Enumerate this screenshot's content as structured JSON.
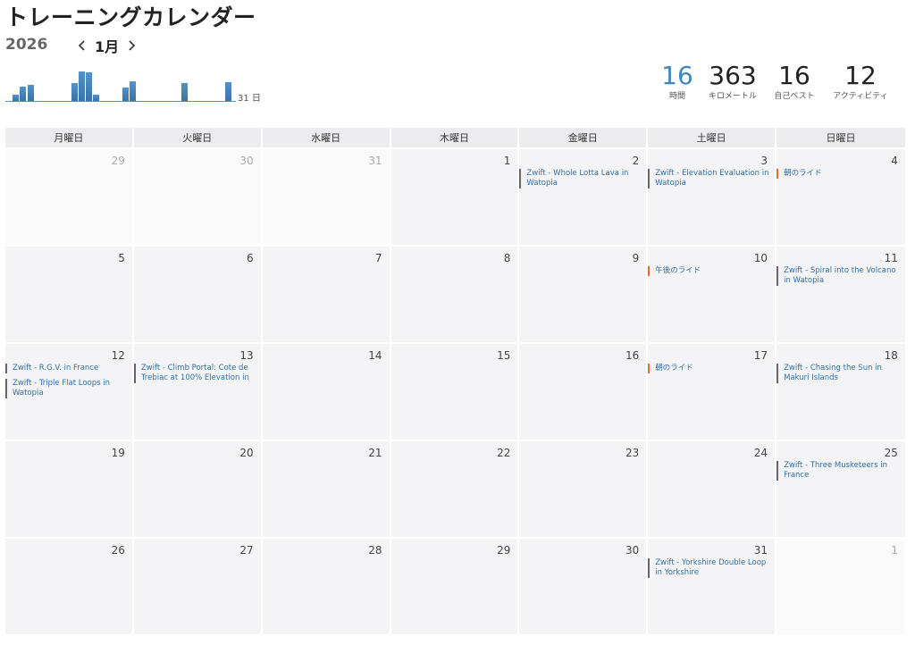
{
  "page": {
    "title": "トレーニングカレンダー",
    "year": "2026",
    "month": "1月"
  },
  "icons": {
    "prev": "chevron-left-icon",
    "next": "chevron-right-icon"
  },
  "colors": {
    "accent": "#3f86c1",
    "event_default_marker": "#666666",
    "event_outdoor_marker": "#e06a38",
    "event_text": "#2f6fa8"
  },
  "histogram": {
    "days_label": "31 日",
    "bars": [
      {
        "day": 2,
        "level": 0.2
      },
      {
        "day": 3,
        "level": 0.45
      },
      {
        "day": 4,
        "level": 0.5
      },
      {
        "day": 10,
        "level": 0.55
      },
      {
        "day": 11,
        "level": 0.92
      },
      {
        "day": 12,
        "level": 0.88
      },
      {
        "day": 13,
        "level": 0.2
      },
      {
        "day": 17,
        "level": 0.42
      },
      {
        "day": 18,
        "level": 0.6
      },
      {
        "day": 25,
        "level": 0.55
      },
      {
        "day": 31,
        "level": 0.58
      }
    ]
  },
  "stats": [
    {
      "value": "16",
      "label": "時間",
      "accent": true
    },
    {
      "value": "363",
      "label": "キロメートル",
      "accent": false
    },
    {
      "value": "16",
      "label": "自己ベスト",
      "accent": false
    },
    {
      "value": "12",
      "label": "アクティビティ",
      "accent": false
    }
  ],
  "weekdays": [
    "月曜日",
    "火曜日",
    "水曜日",
    "木曜日",
    "金曜日",
    "土曜日",
    "日曜日"
  ],
  "weeks": [
    [
      {
        "day": "29",
        "outside": true,
        "events": []
      },
      {
        "day": "30",
        "outside": true,
        "events": []
      },
      {
        "day": "31",
        "outside": true,
        "events": []
      },
      {
        "day": "1",
        "outside": false,
        "events": []
      },
      {
        "day": "2",
        "outside": false,
        "events": [
          {
            "title": "Zwift - Whole Lotta Lava in Watopia",
            "type": "zwift"
          }
        ]
      },
      {
        "day": "3",
        "outside": false,
        "events": [
          {
            "title": "Zwift - Elevation Evaluation in Watopia",
            "type": "zwift"
          }
        ]
      },
      {
        "day": "4",
        "outside": false,
        "events": [
          {
            "title": "朝のライド",
            "type": "ride"
          }
        ]
      }
    ],
    [
      {
        "day": "5",
        "outside": false,
        "events": []
      },
      {
        "day": "6",
        "outside": false,
        "events": []
      },
      {
        "day": "7",
        "outside": false,
        "events": []
      },
      {
        "day": "8",
        "outside": false,
        "events": []
      },
      {
        "day": "9",
        "outside": false,
        "events": []
      },
      {
        "day": "10",
        "outside": false,
        "events": [
          {
            "title": "午後のライド",
            "type": "ride"
          }
        ]
      },
      {
        "day": "11",
        "outside": false,
        "events": [
          {
            "title": "Zwift - Spiral into the Volcano in Watopia",
            "type": "zwift"
          }
        ]
      }
    ],
    [
      {
        "day": "12",
        "outside": false,
        "events": [
          {
            "title": "Zwift - R.G.V. in France",
            "type": "zwift"
          },
          {
            "title": "Zwift - Triple Flat Loops in Watopia",
            "type": "zwift"
          }
        ]
      },
      {
        "day": "13",
        "outside": false,
        "events": [
          {
            "title": "Zwift - Climb Portal: Cote de Trebiac at 100% Elevation in",
            "type": "zwift"
          }
        ]
      },
      {
        "day": "14",
        "outside": false,
        "events": []
      },
      {
        "day": "15",
        "outside": false,
        "events": []
      },
      {
        "day": "16",
        "outside": false,
        "events": []
      },
      {
        "day": "17",
        "outside": false,
        "events": [
          {
            "title": "朝のライド",
            "type": "ride"
          }
        ]
      },
      {
        "day": "18",
        "outside": false,
        "events": [
          {
            "title": "Zwift - Chasing the Sun in Makuri Islands",
            "type": "zwift"
          }
        ]
      }
    ],
    [
      {
        "day": "19",
        "outside": false,
        "events": []
      },
      {
        "day": "20",
        "outside": false,
        "events": []
      },
      {
        "day": "21",
        "outside": false,
        "events": []
      },
      {
        "day": "22",
        "outside": false,
        "events": []
      },
      {
        "day": "23",
        "outside": false,
        "events": []
      },
      {
        "day": "24",
        "outside": false,
        "events": []
      },
      {
        "day": "25",
        "outside": false,
        "events": [
          {
            "title": "Zwift - Three Musketeers in France",
            "type": "zwift"
          }
        ]
      }
    ],
    [
      {
        "day": "26",
        "outside": false,
        "events": []
      },
      {
        "day": "27",
        "outside": false,
        "events": []
      },
      {
        "day": "28",
        "outside": false,
        "events": []
      },
      {
        "day": "29",
        "outside": false,
        "events": []
      },
      {
        "day": "30",
        "outside": false,
        "events": []
      },
      {
        "day": "31",
        "outside": false,
        "events": [
          {
            "title": "Zwift - Yorkshire Double Loop in Yorkshire",
            "type": "zwift"
          }
        ]
      },
      {
        "day": "1",
        "outside": true,
        "events": []
      }
    ]
  ]
}
